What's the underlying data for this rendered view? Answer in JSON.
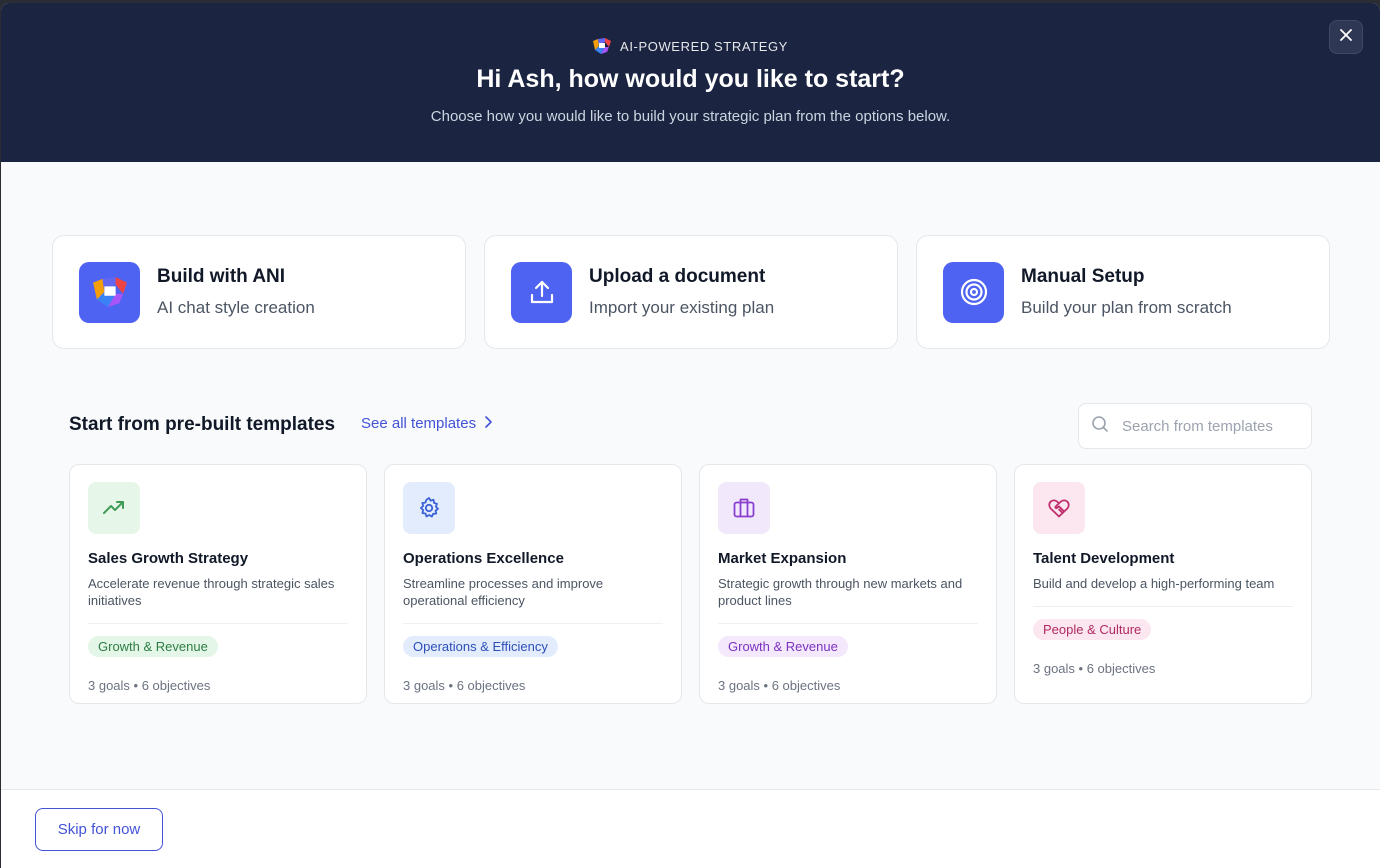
{
  "header": {
    "eyebrow": "AI-POWERED STRATEGY",
    "title": "Hi Ash, how would you like to start?",
    "subtitle": "Choose how you would like to build your strategic plan from the options below.",
    "close_icon": "close-icon"
  },
  "options": [
    {
      "title": "Build with ANI",
      "subtitle": "AI chat style creation",
      "icon": "ani-logo-icon"
    },
    {
      "title": "Upload a document",
      "subtitle": "Import your existing plan",
      "icon": "upload-icon"
    },
    {
      "title": "Manual Setup",
      "subtitle": "Build your plan from scratch",
      "icon": "target-icon"
    }
  ],
  "templates_section": {
    "title": "Start from pre-built templates",
    "see_all": "See all templates",
    "search_placeholder": "Search from templates"
  },
  "templates": [
    {
      "name": "Sales Growth Strategy",
      "description": "Accelerate revenue through strategic sales initiatives",
      "tag": "Growth & Revenue",
      "meta": "3 goals • 6 objectives",
      "icon": "trending-up-icon",
      "icon_color": "#3f9b55",
      "icon_bg": "#e6f7ea",
      "tag_color": "#2f7d43",
      "tag_bg": "#e3f6e7"
    },
    {
      "name": "Operations Excellence",
      "description": "Streamline processes and improve operational efficiency",
      "tag": "Operations & Efficiency",
      "meta": "3 goals • 6 objectives",
      "icon": "gear-icon",
      "icon_color": "#3b63d6",
      "icon_bg": "#e3ecfd",
      "tag_color": "#2c4fb8",
      "tag_bg": "#e3ecfd"
    },
    {
      "name": "Market Expansion",
      "description": "Strategic growth through new markets and product lines",
      "tag": "Growth & Revenue",
      "meta": "3 goals • 6 objectives",
      "icon": "briefcase-icon",
      "icon_color": "#8b3fd0",
      "icon_bg": "#f1e8fb",
      "tag_color": "#7b33c0",
      "tag_bg": "#f3e8fc"
    },
    {
      "name": "Talent Development",
      "description": "Build and develop a high-performing team",
      "tag": "People & Culture",
      "meta": "3 goals • 6 objectives",
      "icon": "heart-handshake-icon",
      "icon_color": "#c0306e",
      "icon_bg": "#fce6ef",
      "tag_color": "#b02a63",
      "tag_bg": "#fce6ef"
    }
  ],
  "footer": {
    "skip_label": "Skip for now"
  },
  "colors": {
    "accent": "#4f63f3",
    "hero_bg": "#1b2440"
  }
}
